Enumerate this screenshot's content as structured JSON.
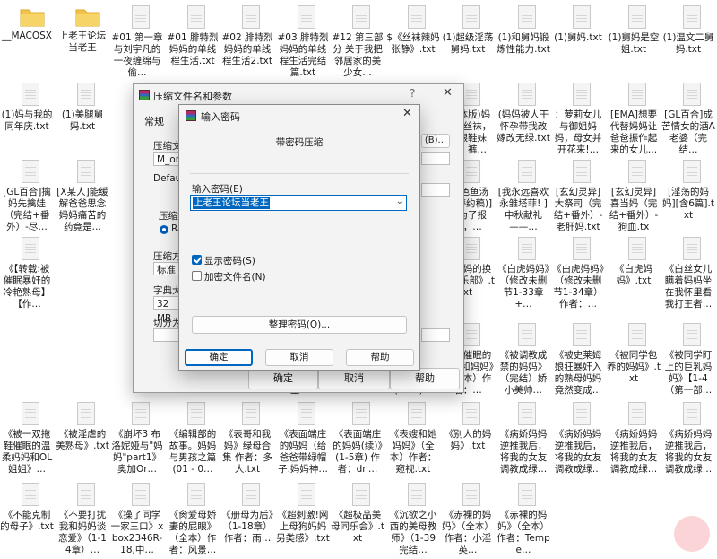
{
  "desktop": {
    "tiles": [
      {
        "label": "__MACOSX",
        "kind": "folder"
      },
      {
        "label": "上老王论坛当老王",
        "kind": "folder"
      },
      {
        "label": "#01 第一章 与刘宇凡的一夜缠绵与偷…",
        "kind": "doc"
      },
      {
        "label": "#01 腓特烈妈妈的单线程生活.txt",
        "kind": "doc"
      },
      {
        "label": "#02 腓特烈妈妈的单线程生活2.txt",
        "kind": "doc"
      },
      {
        "label": "#03 腓特烈妈妈的单线程生活完结篇.txt",
        "kind": "doc"
      },
      {
        "label": "#12 第三部分 关于我把邻居家的美少女…",
        "kind": "doc"
      },
      {
        "label": "$《丝袜辣妈张静》.txt",
        "kind": "doc"
      },
      {
        "label": "(1)超级淫荡舅妈.txt",
        "kind": "doc"
      },
      {
        "label": "(1)和舅妈锻炼性能力.txt",
        "kind": "doc"
      },
      {
        "label": "(1)舅妈.txt",
        "kind": "doc"
      },
      {
        "label": "(1)舅妈是空姐.txt",
        "kind": "doc"
      },
      {
        "label": "(1)温文二舅妈.txt",
        "kind": "doc"
      },
      {
        "label": "(1)妈与我的同年庆.txt",
        "kind": "doc"
      },
      {
        "label": "(1)美腿舅妈.txt",
        "kind": "doc"
      },
      {
        "label": "",
        "kind": "hidden"
      },
      {
        "label": "",
        "kind": "hidden"
      },
      {
        "label": "",
        "kind": "hidden"
      },
      {
        "label": "",
        "kind": "hidden"
      },
      {
        "label": "",
        "kind": "hidden"
      },
      {
        "label": "",
        "kind": "hidden"
      },
      {
        "label": "(简体版)妈妈，丝袜，高跟鞋妹妹，裤…",
        "kind": "doc"
      },
      {
        "label": "(妈妈被人干怀孕带我改嫁改无绿.txt",
        "kind": "doc"
      },
      {
        "label": "：萝莉女儿与御姐妈妈，母女并开花来!…",
        "kind": "doc"
      },
      {
        "label": "[EMA]想要代替妈妈让爸爸振作起来的女儿…",
        "kind": "doc"
      },
      {
        "label": "[GL百合]成苦情女的酒A老婆（完结…",
        "kind": "doc"
      },
      {
        "label": "[GL百合]擒妈先擒娃（完结+番外）-尽…",
        "kind": "doc"
      },
      {
        "label": "[X某人]能缓解爸爸思念妈妈痛苦的药竟是…",
        "kind": "doc"
      },
      {
        "label": "",
        "kind": "hidden"
      },
      {
        "label": "",
        "kind": "hidden"
      },
      {
        "label": "",
        "kind": "hidden"
      },
      {
        "label": "",
        "kind": "hidden"
      },
      {
        "label": "",
        "kind": "hidden"
      },
      {
        "label": "[暮色鱼汤(暂停约稿)]《为了报复，…",
        "kind": "doc"
      },
      {
        "label": "[暮色鱼汤(暂停约稿)]《为了报复，…",
        "kind": "doc"
      },
      {
        "label": "[我永远喜欢永雏塔菲! ]中秋献礼——…",
        "kind": "doc"
      },
      {
        "label": "[玄幻灵异]大祭司（完结+番外）-老肝妈.txt",
        "kind": "doc"
      },
      {
        "label": "[玄幻灵异]喜当妈（完结+番外）-狗血.tx",
        "kind": "doc"
      },
      {
        "label": "[淫荡的妈妈][含6篇].txt",
        "kind": "doc"
      },
      {
        "label": "《【转载:被催眠暴奸的冷艳熟母】【作…",
        "kind": "doc"
      },
      {
        "label": "",
        "kind": "hidden"
      },
      {
        "label": "",
        "kind": "hidden"
      },
      {
        "label": "",
        "kind": "hidden"
      },
      {
        "label": "",
        "kind": "hidden"
      },
      {
        "label": "",
        "kind": "hidden"
      },
      {
        "label": "《俺妹不可能这么可爱》同人一京介和…",
        "kind": "doc"
      },
      {
        "label": "《爸爸让我肏妈妈》（1-13章+续全本+附…",
        "kind": "doc"
      },
      {
        "label": "《爸妈的换妻俱乐部》.txt",
        "kind": "doc"
      },
      {
        "label": "《白虎妈妈》（修改未删节1-33章+…",
        "kind": "doc"
      },
      {
        "label": "《白虎妈妈》（修改未删节1-34章）作者：…",
        "kind": "doc"
      },
      {
        "label": "《白虎妈妈》.txt",
        "kind": "doc"
      },
      {
        "label": "《白丝女儿瞒着妈妈坐在我怀里看我打王者…",
        "kind": "doc"
      },
      {
        "label": "",
        "kind": "hidden"
      },
      {
        "label": "",
        "kind": "hidden"
      },
      {
        "label": "",
        "kind": "hidden"
      },
      {
        "label": "",
        "kind": "hidden"
      },
      {
        "label": "",
        "kind": "hidden"
      },
      {
        "label": "《宝贝妈妈蓝菲菲》作者：青楼楼主.txt",
        "kind": "doc"
      },
      {
        "label": "《保护美艳的妈妈》作者：未知.txt",
        "kind": "doc"
      },
      {
        "label": "《报告妈妈，我才是一家之主》(1-11)…",
        "kind": "doc"
      },
      {
        "label": "《被催眠的阿姨和妈妈》（全本）作者：…",
        "kind": "doc"
      },
      {
        "label": "《被调教成禁的妈妈》（完结）娇小美帅…",
        "kind": "doc"
      },
      {
        "label": "《被史莱姆娘狂暴奸入的熟母妈妈竟然变成…",
        "kind": "doc"
      },
      {
        "label": "《被同学包养的妈妈》.txt",
        "kind": "doc"
      },
      {
        "label": "《被同学盯上的巨乳妈妈》【1-4（第一部…",
        "kind": "doc"
      },
      {
        "label": "《被一双拖鞋催眠的温柔妈妈和OL姐姐》…",
        "kind": "doc"
      },
      {
        "label": "《被淫虐的美熟母》.txt",
        "kind": "doc"
      },
      {
        "label": "《崩坏3 布洛妮娅与\"妈妈\"part1》奥加Or…",
        "kind": "doc"
      },
      {
        "label": "《编辑部的故事。妈妈与男孩之篇(01 - 0…",
        "kind": "doc"
      },
      {
        "label": "《表哥和我妈》绿母合集 作者：多人.txt",
        "kind": "doc"
      },
      {
        "label": "《表面端庄的妈妈（给爸爸带绿帽子.妈妈神…",
        "kind": "doc"
      },
      {
        "label": "《表面端庄的妈妈(续)》(1-5章) 作者：dn…",
        "kind": "doc"
      },
      {
        "label": "《表嫂和她妈妈》（全本）作者：窥视.txt",
        "kind": "doc"
      },
      {
        "label": "《别人的妈妈》.txt",
        "kind": "doc"
      },
      {
        "label": "《病娇妈妈逆推我后，将我的女友调教成绿…",
        "kind": "doc"
      },
      {
        "label": "《病娇妈妈逆推我后，将我的女友调教成绿…",
        "kind": "doc"
      },
      {
        "label": "《病娇妈妈逆推我后，将我的女友调教成绿…",
        "kind": "doc"
      },
      {
        "label": "《病娇妈妈逆推我后，将我的女友调教成绿…",
        "kind": "doc"
      },
      {
        "label": "《不能克制的母子》.txt",
        "kind": "doc"
      },
      {
        "label": "《不要打扰我和妈妈谈恋爱》（1-14章）…",
        "kind": "doc"
      },
      {
        "label": "《操了同学一家三口》xbox2346R-18,中…",
        "kind": "doc"
      },
      {
        "label": "《肏爱母娇妻的屁眼》（全本）作者：风景…",
        "kind": "doc"
      },
      {
        "label": "《册母为后》（1-18章）作者：雨…",
        "kind": "doc"
      },
      {
        "label": "《超刺激!网上母狗妈妈另类感》.txt",
        "kind": "doc"
      },
      {
        "label": "《超极品美母同乐会》.txt",
        "kind": "doc"
      },
      {
        "label": "《沉欲之小西的美母教师》（1-39完结…",
        "kind": "doc"
      },
      {
        "label": "《赤裸的妈妈》（全本）作者：小淫英…",
        "kind": "doc"
      },
      {
        "label": "《赤裸的妈妈》（全本）作者：Tempe…",
        "kind": "doc"
      }
    ]
  },
  "archive_dialog": {
    "title": "压缩文件名和参数",
    "help_glyph": "?",
    "close_glyph": "✕",
    "tab_general": "常规",
    "label_filename": "压缩文",
    "filename_value": "M_one",
    "browse_label": "(B)...",
    "label_default": "Default",
    "label_format": "压缩文",
    "format_radio": "RA",
    "label_method": "压缩方",
    "method_value": "标准",
    "label_dict": "字典大小",
    "dict_value": "32 MB",
    "label_split": "切分为分",
    "ok_label": "确定",
    "cancel_label": "取消",
    "help_label": "帮助"
  },
  "password_dialog": {
    "title": "输入密码",
    "close_glyph": "✕",
    "group_title": "带密码压缩",
    "password_label": "输入密码(E)",
    "password_value": "上老王论坛当老王",
    "dropdown_glyph": "⌄",
    "show_password_label": "显示密码(S)",
    "show_password_checked": true,
    "encrypt_filenames_label": "加密文件名(N)",
    "encrypt_filenames_checked": false,
    "manage_button": "整理密码(O)...",
    "ok_label": "确定",
    "cancel_label": "取消",
    "help_label": "帮助"
  }
}
